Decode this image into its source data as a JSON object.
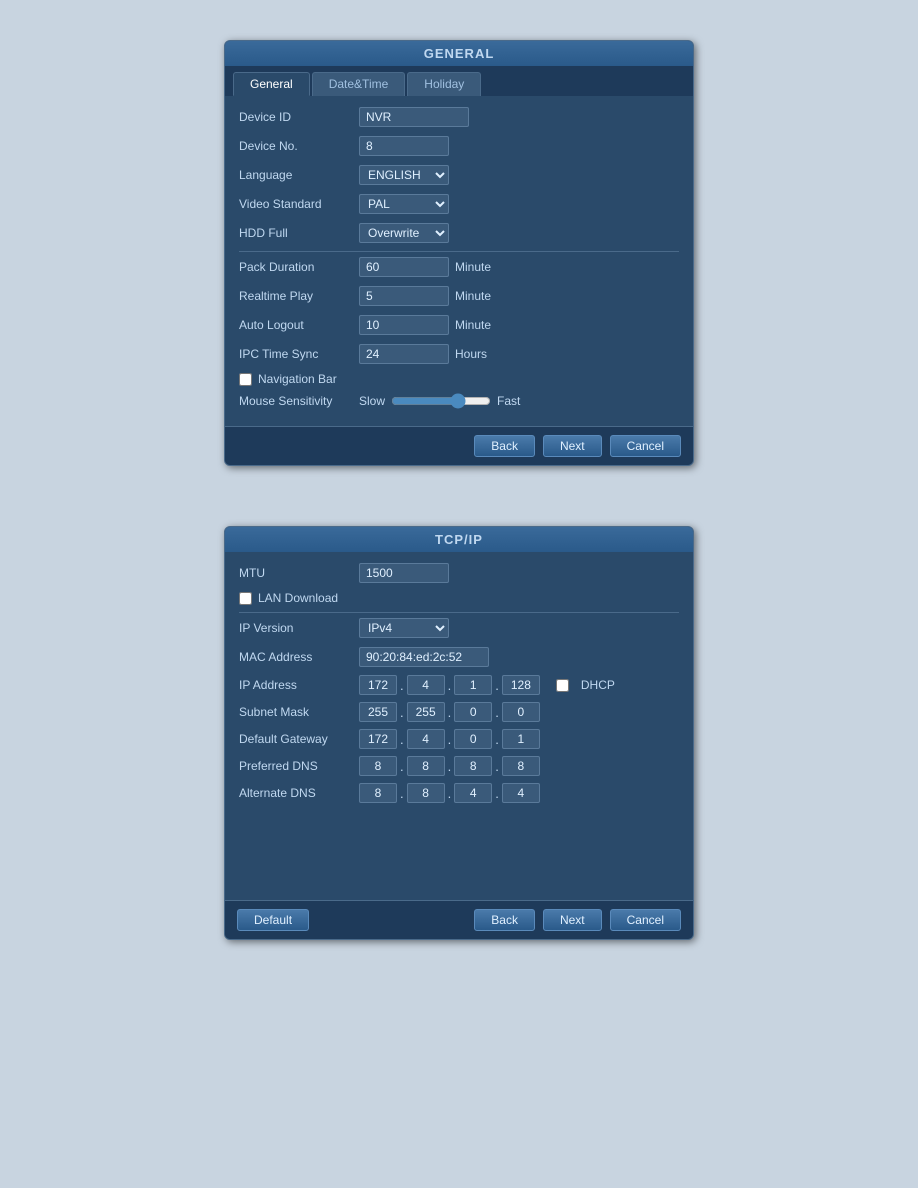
{
  "general_dialog": {
    "title": "GENERAL",
    "tabs": [
      {
        "label": "General",
        "active": true
      },
      {
        "label": "Date&Time",
        "active": false
      },
      {
        "label": "Holiday",
        "active": false
      }
    ],
    "fields": {
      "device_id_label": "Device ID",
      "device_id_value": "NVR",
      "device_no_label": "Device No.",
      "device_no_value": "8",
      "language_label": "Language",
      "language_value": "ENGLISH",
      "video_standard_label": "Video Standard",
      "video_standard_value": "PAL",
      "hdd_full_label": "HDD Full",
      "hdd_full_value": "Overwrite",
      "pack_duration_label": "Pack Duration",
      "pack_duration_value": "60",
      "pack_duration_unit": "Minute",
      "realtime_play_label": "Realtime Play",
      "realtime_play_value": "5",
      "realtime_play_unit": "Minute",
      "auto_logout_label": "Auto Logout",
      "auto_logout_value": "10",
      "auto_logout_unit": "Minute",
      "ipc_time_sync_label": "IPC Time Sync",
      "ipc_time_sync_value": "24",
      "ipc_time_sync_unit": "Hours",
      "navigation_bar_label": "Navigation Bar",
      "mouse_sensitivity_label": "Mouse Sensitivity",
      "mouse_slow_label": "Slow",
      "mouse_fast_label": "Fast"
    },
    "footer": {
      "back_label": "Back",
      "next_label": "Next",
      "cancel_label": "Cancel"
    }
  },
  "tcpip_dialog": {
    "title": "TCP/IP",
    "fields": {
      "mtu_label": "MTU",
      "mtu_value": "1500",
      "lan_download_label": "LAN Download",
      "ip_version_label": "IP Version",
      "ip_version_value": "IPv4",
      "mac_address_label": "MAC Address",
      "mac_address_value": "90:20:84:ed:2c:52",
      "ip_address_label": "IP Address",
      "ip_oct1": "172",
      "ip_oct2": "4",
      "ip_oct3": "1",
      "ip_oct4": "128",
      "dhcp_label": "DHCP",
      "subnet_mask_label": "Subnet Mask",
      "sm_oct1": "255",
      "sm_oct2": "255",
      "sm_oct3": "0",
      "sm_oct4": "0",
      "default_gateway_label": "Default Gateway",
      "gw_oct1": "172",
      "gw_oct2": "4",
      "gw_oct3": "0",
      "gw_oct4": "1",
      "preferred_dns_label": "Preferred DNS",
      "dns1_oct1": "8",
      "dns1_oct2": "8",
      "dns1_oct3": "8",
      "dns1_oct4": "8",
      "alternate_dns_label": "Alternate DNS",
      "dns2_oct1": "8",
      "dns2_oct2": "8",
      "dns2_oct3": "4",
      "dns2_oct4": "4"
    },
    "footer": {
      "default_label": "Default",
      "back_label": "Back",
      "next_label": "Next",
      "cancel_label": "Cancel"
    }
  }
}
